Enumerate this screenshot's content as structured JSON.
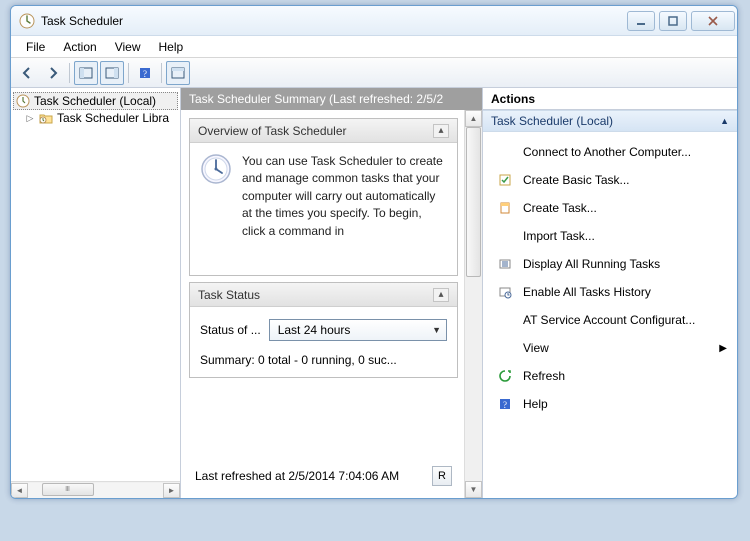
{
  "window": {
    "title": "Task Scheduler"
  },
  "menubar": {
    "file": "File",
    "action": "Action",
    "view": "View",
    "help": "Help"
  },
  "tree": {
    "root": "Task Scheduler (Local)",
    "lib": "Task Scheduler Libra"
  },
  "summary": {
    "header": "Task Scheduler Summary (Last refreshed: 2/5/2",
    "overview_title": "Overview of Task Scheduler",
    "overview_text": "You can use Task Scheduler to create and manage common tasks that your computer will carry out automatically at the times you specify. To begin, click a command in",
    "status_title": "Task Status",
    "status_label": "Status of ...",
    "status_period": "Last 24 hours",
    "status_summary": "Summary: 0 total - 0 running, 0 suc...",
    "last_refreshed": "Last refreshed at 2/5/2014 7:04:06 AM",
    "refresh_btn": "R"
  },
  "actions": {
    "header": "Actions",
    "section": "Task Scheduler (Local)",
    "items": {
      "connect": "Connect to Another Computer...",
      "create_basic": "Create Basic Task...",
      "create": "Create Task...",
      "import": "Import Task...",
      "running": "Display All Running Tasks",
      "history": "Enable All Tasks History",
      "at": "AT Service Account Configurat...",
      "view": "View",
      "refresh": "Refresh",
      "help": "Help"
    }
  }
}
